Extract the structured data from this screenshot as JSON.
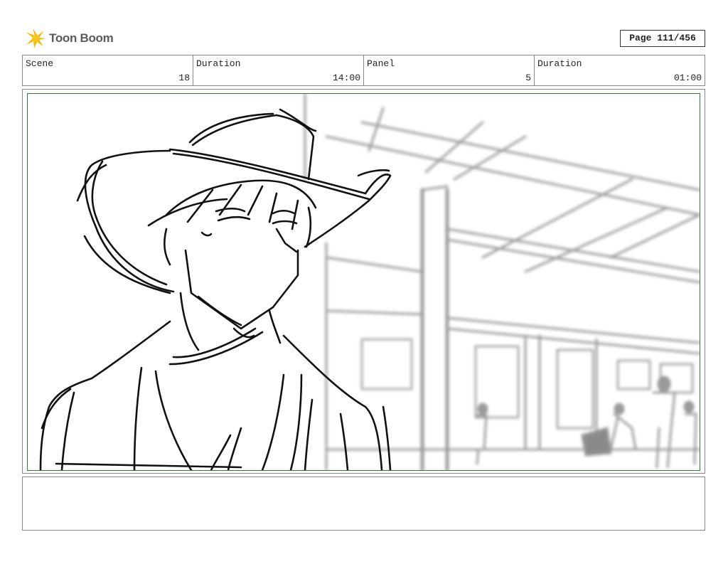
{
  "brand": {
    "name": "Toon Boom"
  },
  "page": {
    "label": "Page 111/456"
  },
  "info": {
    "scene_label": "Scene",
    "scene_value": "18",
    "duration_label": "Duration",
    "duration_value": "14:00",
    "panel_label": "Panel",
    "panel_value": "5",
    "panel_duration_label": "Duration",
    "panel_duration_value": "01:00"
  },
  "panel_image": {
    "description_icon": "storyboard-sketch"
  },
  "caption": {
    "text": ""
  }
}
